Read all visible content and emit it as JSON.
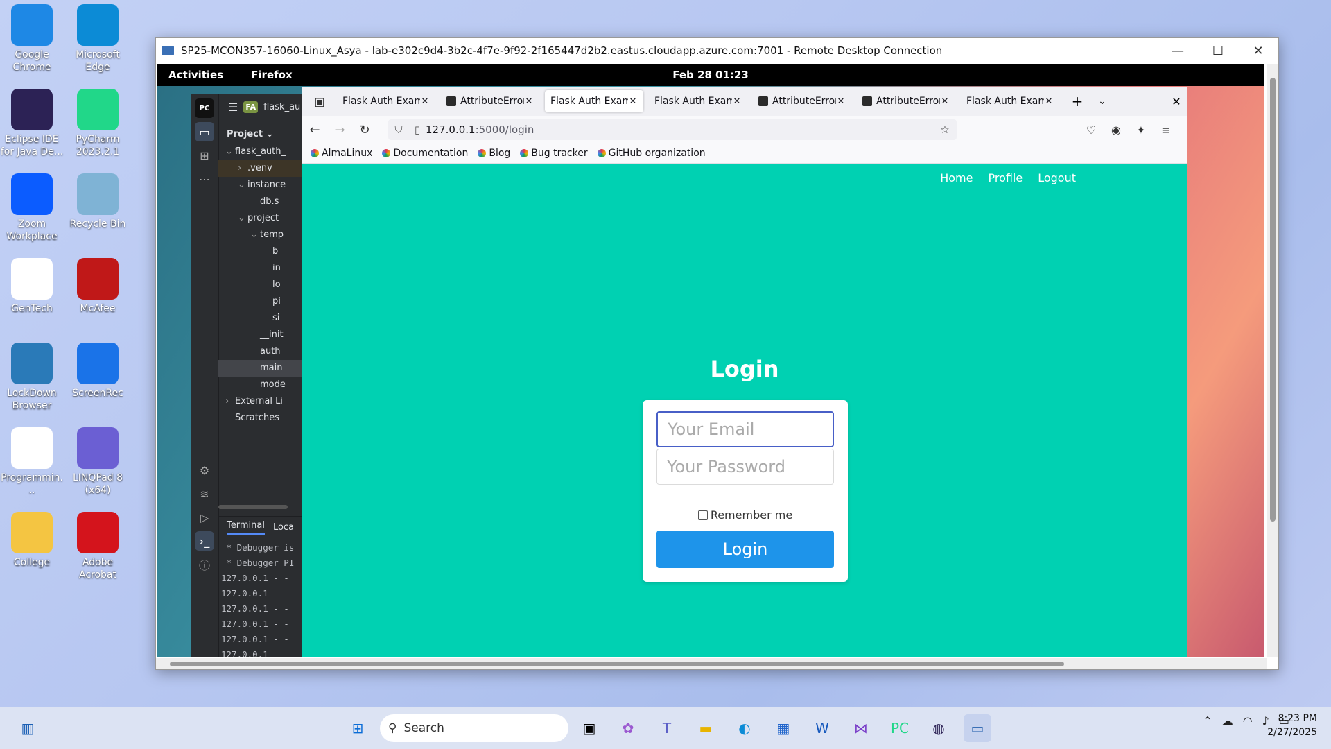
{
  "desktop": {
    "icons": [
      {
        "label": "Google Chrome",
        "color": "#1e88e5"
      },
      {
        "label": "Microsoft Edge",
        "color": "#0c8bd6"
      },
      {
        "label": "Eclipse IDE for Java De...",
        "color": "#2c2255"
      },
      {
        "label": "PyCharm 2023.2.1",
        "color": "#21d789"
      },
      {
        "label": "Zoom Workplace",
        "color": "#0b5cff"
      },
      {
        "label": "Recycle Bin",
        "color": "#7fb3d5"
      },
      {
        "label": "GenTech",
        "color": "#ffffff"
      },
      {
        "label": "McAfee",
        "color": "#c01818"
      },
      {
        "label": "LockDown Browser",
        "color": "#2a7ab8"
      },
      {
        "label": "ScreenRec",
        "color": "#1a73e8"
      },
      {
        "label": "Programmin...",
        "color": "#ffffff"
      },
      {
        "label": "LINQPad 8 (x64)",
        "color": "#6b5fd3"
      },
      {
        "label": "College",
        "color": "#f4c542"
      },
      {
        "label": "Adobe Acrobat",
        "color": "#d4141c"
      }
    ]
  },
  "rdp": {
    "title": "SP25-MCON357-16060-Linux_Asya - lab-e302c9d4-3b2c-4f7e-9f92-2f165447d2b2.eastus.cloudapp.azure.com:7001 - Remote Desktop Connection",
    "minimize": "—",
    "maximize": "☐",
    "close": "✕"
  },
  "gnome": {
    "activities": "Activities",
    "app": "Firefox",
    "clock": "Feb 28  01:23"
  },
  "pycharm": {
    "logo": "PC",
    "badge": "FA",
    "project_name": "flask_au",
    "project_label": "Project",
    "tree": [
      {
        "text": "flask_auth_",
        "indent": 0,
        "arrow": "⌄"
      },
      {
        "text": ".venv",
        "indent": 1,
        "arrow": "›"
      },
      {
        "text": "instance",
        "indent": 1,
        "arrow": "⌄"
      },
      {
        "text": "db.s",
        "indent": 2,
        "arrow": ""
      },
      {
        "text": "project",
        "indent": 1,
        "arrow": "⌄"
      },
      {
        "text": "temp",
        "indent": 2,
        "arrow": "⌄"
      },
      {
        "text": "b",
        "indent": 3,
        "arrow": ""
      },
      {
        "text": "in",
        "indent": 3,
        "arrow": ""
      },
      {
        "text": "lo",
        "indent": 3,
        "arrow": ""
      },
      {
        "text": "pi",
        "indent": 3,
        "arrow": ""
      },
      {
        "text": "si",
        "indent": 3,
        "arrow": ""
      },
      {
        "text": "__init",
        "indent": 2,
        "arrow": ""
      },
      {
        "text": "auth",
        "indent": 2,
        "arrow": ""
      },
      {
        "text": "main",
        "indent": 2,
        "arrow": ""
      },
      {
        "text": "mode",
        "indent": 2,
        "arrow": ""
      },
      {
        "text": "External Li",
        "indent": 0,
        "arrow": "›"
      },
      {
        "text": "Scratches",
        "indent": 0,
        "arrow": ""
      }
    ],
    "terminal_tab": "Terminal",
    "local_tab": "Loca",
    "terminal_lines": " * Debugger is\n * Debugger PI\n127.0.0.1 - -\n127.0.0.1 - -\n127.0.0.1 - -\n127.0.0.1 - -\n127.0.0.1 - -\n127.0.0.1 - -"
  },
  "firefox": {
    "tabs": [
      {
        "title": "Flask Auth Examp",
        "icon": false,
        "active": false
      },
      {
        "title": "AttributeError",
        "icon": true,
        "active": false
      },
      {
        "title": "Flask Auth Examp",
        "icon": false,
        "active": true
      },
      {
        "title": "Flask Auth Examp",
        "icon": false,
        "active": false
      },
      {
        "title": "AttributeError",
        "icon": true,
        "active": false
      },
      {
        "title": "AttributeError",
        "icon": true,
        "active": false
      },
      {
        "title": "Flask Auth Examp",
        "icon": false,
        "active": false
      }
    ],
    "url_host": "127.0.0.1",
    "url_path": ":5000/login",
    "bookmarks": [
      "AlmaLinux",
      "Documentation",
      "Blog",
      "Bug tracker",
      "GitHub organization"
    ]
  },
  "page": {
    "nav": [
      "Home",
      "Profile",
      "Logout"
    ],
    "title": "Login",
    "email_placeholder": "Your Email",
    "password_placeholder": "Your Password",
    "remember_label": "Remember me",
    "submit_label": "Login",
    "accent": "#00d1b2",
    "button_color": "#1e94ea"
  },
  "taskbar": {
    "search_label": "Search",
    "time": "8:23 PM",
    "date": "2/27/2025"
  }
}
